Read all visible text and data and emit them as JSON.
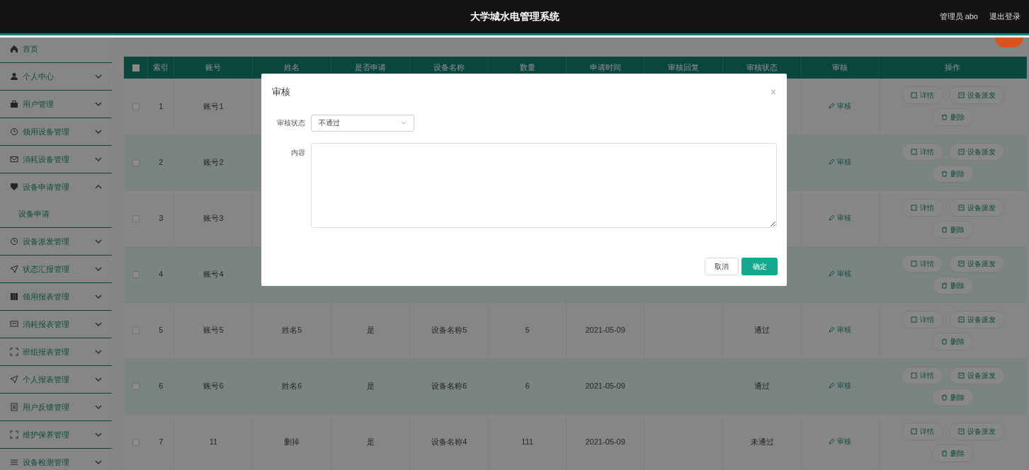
{
  "header": {
    "title": "大学城水电管理系统",
    "user": "管理员 abo",
    "logout": "退出登录"
  },
  "sidebar": {
    "items": [
      {
        "label": "首页"
      },
      {
        "label": "个人中心",
        "expanded": false
      },
      {
        "label": "用户管理",
        "expanded": false
      },
      {
        "label": "领用设备管理",
        "expanded": false
      },
      {
        "label": "消耗设备管理",
        "expanded": false
      },
      {
        "label": "设备申请管理",
        "expanded": true,
        "children": [
          {
            "label": "设备申请"
          }
        ]
      },
      {
        "label": "设备派发管理",
        "expanded": false
      },
      {
        "label": "状态汇报管理",
        "expanded": false
      },
      {
        "label": "领用报表管理",
        "expanded": false
      },
      {
        "label": "消耗报表管理",
        "expanded": false
      },
      {
        "label": "班组报表管理",
        "expanded": false
      },
      {
        "label": "个人报表管理",
        "expanded": false
      },
      {
        "label": "用户反馈管理",
        "expanded": false
      },
      {
        "label": "维护保养管理",
        "expanded": false
      },
      {
        "label": "设备检测管理",
        "expanded": false
      }
    ]
  },
  "table": {
    "all_checked": false,
    "columns": [
      "索引",
      "账号",
      "姓名",
      "是否申请",
      "设备名称",
      "数量",
      "申请时间",
      "审核回复",
      "审核状态",
      "审核",
      "操作"
    ],
    "rows": [
      {
        "index": "1",
        "account": "账号1",
        "checked": false,
        "review": "审核",
        "actions": [
          "详情",
          "设备派发",
          "删除"
        ]
      },
      {
        "index": "2",
        "account": "账号2",
        "checked": false,
        "review": "审核",
        "actions": [
          "详情",
          "设备派发",
          "删除"
        ]
      },
      {
        "index": "3",
        "account": "账号3",
        "checked": false,
        "review": "审核",
        "actions": [
          "详情",
          "设备派发",
          "删除"
        ]
      },
      {
        "index": "4",
        "account": "账号4",
        "checked": false,
        "review": "审核",
        "actions": [
          "详情",
          "设备派发",
          "删除"
        ]
      },
      {
        "index": "5",
        "account": "账号5",
        "name": "姓名5",
        "applied": "是",
        "device": "设备名称5",
        "quantity": "5",
        "date": "2021-05-09",
        "status": "通过",
        "checked": false,
        "review": "审核",
        "actions": [
          "详情",
          "设备派发",
          "删除"
        ]
      },
      {
        "index": "6",
        "account": "账号6",
        "name": "姓名6",
        "applied": "是",
        "device": "设备名称6",
        "quantity": "6",
        "date": "2021-05-09",
        "status": "通过",
        "checked": false,
        "review": "审核",
        "actions": [
          "详情",
          "设备派发",
          "删除"
        ]
      },
      {
        "index": "7",
        "account": "11",
        "name": "删掉",
        "applied": "是",
        "device": "设备名称4",
        "quantity": "111",
        "date": "2021-05-09",
        "status": "未通过",
        "checked": false,
        "review": "审核",
        "actions": [
          "详情",
          "设备派发",
          "删除"
        ]
      }
    ]
  },
  "dialog": {
    "title": "审核",
    "close": "×",
    "status_label": "审核状态",
    "status_value": "不通过",
    "content_label": "内容",
    "cancel": "取消",
    "confirm": "确定"
  }
}
